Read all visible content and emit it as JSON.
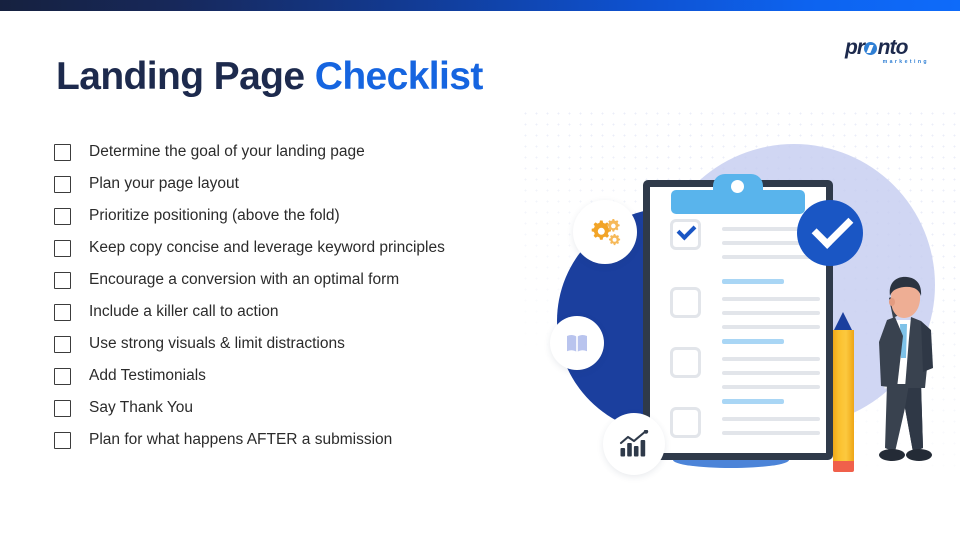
{
  "slide": {
    "title_main": "Landing Page",
    "title_accent": "Checklist",
    "background_color": "#ffffff",
    "topbar": {
      "gradient_from": "#16213f",
      "gradient_to": "#0e6bfa"
    }
  },
  "logo": {
    "word_part1": "pr",
    "word_part2": "nto",
    "tagline": "marketing",
    "dark_color": "#1d2a4d",
    "blue_color": "#2f7fd4"
  },
  "checklist": {
    "items": [
      {
        "label": "Determine the goal of your landing page",
        "checked": false
      },
      {
        "label": "Plan your page layout",
        "checked": false
      },
      {
        "label": "Prioritize positioning (above the fold)",
        "checked": false
      },
      {
        "label": "Keep copy concise and leverage keyword principles",
        "checked": false
      },
      {
        "label": "Encourage a conversion with an optimal form",
        "checked": false
      },
      {
        "label": "Include a killer call to action",
        "checked": false
      },
      {
        "label": "Use strong visuals & limit distractions",
        "checked": false
      },
      {
        "label": "Add Testimonials",
        "checked": false
      },
      {
        "label": "Say Thank You",
        "checked": false
      },
      {
        "label": "Plan for what happens AFTER a submission",
        "checked": false
      }
    ]
  },
  "illustration": {
    "name": "checklist-clipboard-illustration",
    "backdrop_circle_color": "#c6cdf0",
    "navy_circle_color": "#1b3f9e",
    "clipboard": {
      "board_border_color": "#2f3a4a",
      "clip_color": "#59b4ec",
      "checked_items": 1,
      "total_items": 4,
      "check_color": "#1a56c4"
    },
    "check_badge": {
      "name": "blue-check-badge",
      "color": "#1a56c4"
    },
    "pencil": {
      "body_color": "#fbc02d",
      "tip_color": "#1b3f9e",
      "eraser_color": "#f0604b"
    },
    "person": {
      "name": "businessman",
      "suit_color": "#3c4654",
      "tie_color": "#7ec2e8"
    },
    "badges": [
      {
        "name": "gears-icon",
        "color": "#f2a427"
      },
      {
        "name": "book-icon",
        "color": "#b9c4ee"
      },
      {
        "name": "bar-chart-icon",
        "color": "#2f3a4a"
      }
    ]
  }
}
